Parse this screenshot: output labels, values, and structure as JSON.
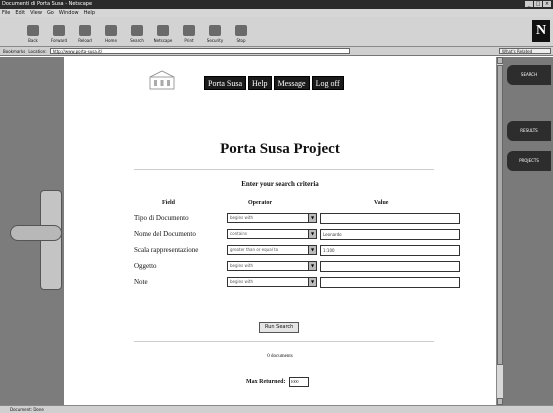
{
  "window": {
    "title": "Documenti di Porta Susa - Netscape"
  },
  "menu": [
    "File",
    "Edit",
    "View",
    "Go",
    "Window",
    "Help"
  ],
  "toolbar": {
    "buttons": [
      "Back",
      "Forward",
      "Reload",
      "Home",
      "Search",
      "Netscape",
      "Print",
      "Security",
      "Stop"
    ],
    "brand": "N"
  },
  "address": {
    "bookmarks_label": "Bookmarks",
    "location_label": "Location:",
    "url": "http://www.porta-susa.it/",
    "related": "What's Related"
  },
  "nav": {
    "items": [
      "Porta Susa",
      "Help",
      "Message",
      "Log off"
    ]
  },
  "page": {
    "title": "Porta Susa Project",
    "criteria_title": "Enter your search criteria",
    "headers": {
      "field": "Field",
      "operator": "Operator",
      "value": "Value"
    },
    "rows": [
      {
        "label": "Tipo di Documento",
        "operator": "begins with",
        "value": ""
      },
      {
        "label": "Nome del Documento",
        "operator": "contains",
        "value": "Leonardo"
      },
      {
        "label": "Scala rappresentazione",
        "operator": "greater than or equal to",
        "value": "1:100"
      },
      {
        "label": "Oggetto",
        "operator": "begins with",
        "value": ""
      },
      {
        "label": "Note",
        "operator": "begins with",
        "value": ""
      }
    ],
    "search_button": "Run Search",
    "no_docs": "0 documents",
    "max_returned_label": "Max Returned:",
    "max_returned_value": "1000"
  },
  "right_tabs": [
    "SEARCH",
    "RESULTS",
    "PROJECTS"
  ],
  "status": "Document: Done"
}
